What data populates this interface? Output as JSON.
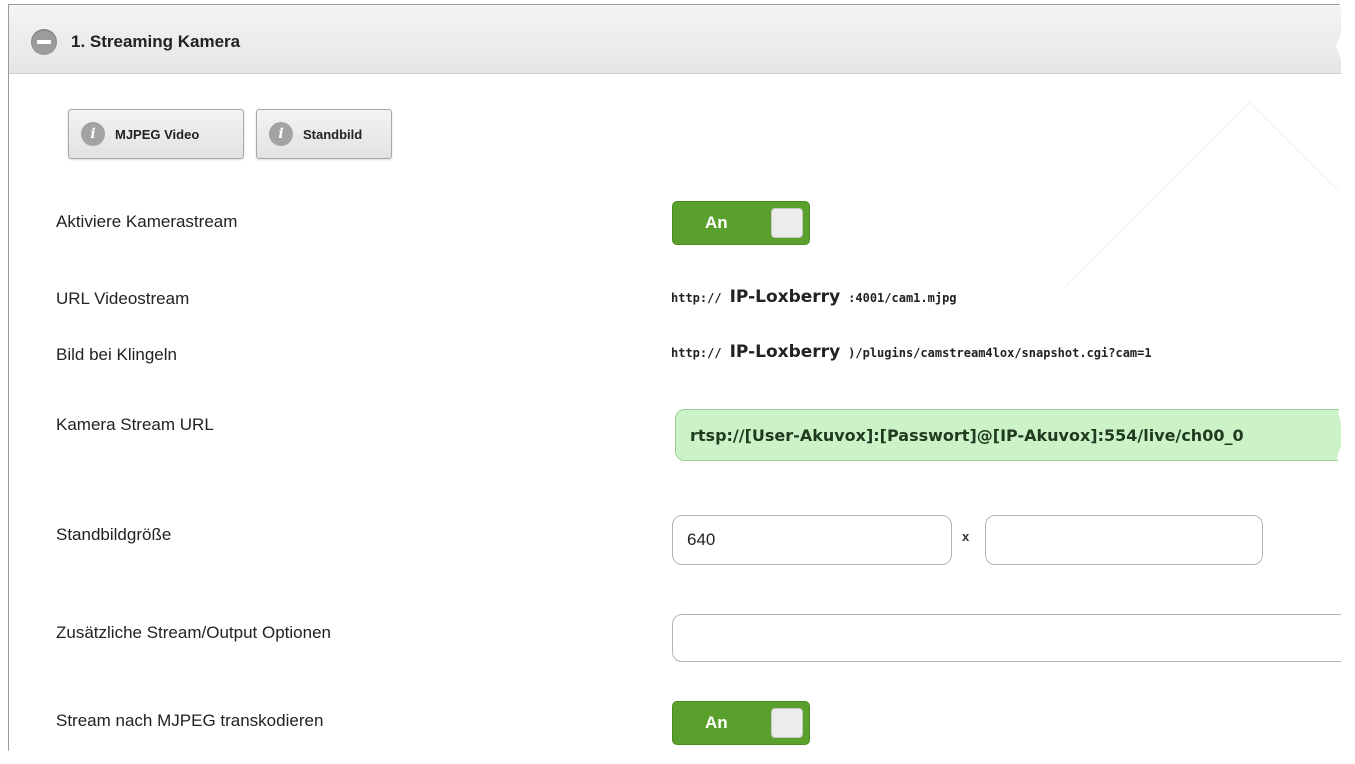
{
  "header": {
    "title": "1. Streaming Kamera"
  },
  "buttons": {
    "mjpeg_video": "MJPEG Video",
    "standbild": "Standbild",
    "info_glyph": "i"
  },
  "rows": {
    "aktiviere": {
      "label": "Aktiviere Kamerastream",
      "toggle_text": "An"
    },
    "url_videostream": {
      "label": "URL Videostream",
      "prefix": "http://",
      "host": "IP-Loxberry",
      "suffix": ":4001/cam1.mjpg"
    },
    "bild_klingeln": {
      "label": "Bild bei Klingeln",
      "prefix": "http://",
      "host": "IP-Loxberry",
      "suffix": ")/plugins/camstream4lox/snapshot.cgi?cam=1"
    },
    "kamera_stream_url": {
      "label": "Kamera Stream URL",
      "value": "rtsp://[User-Akuvox]:[Passwort]@[IP-Akuvox]:554/live/ch00_0"
    },
    "standbildgroesse": {
      "label": "Standbildgröße",
      "width_value": "640",
      "separator": "x",
      "height_value": ""
    },
    "zusaetzliche_optionen": {
      "label": "Zusätzliche Stream/Output Optionen",
      "value": ""
    },
    "transkodieren": {
      "label": "Stream nach MJPEG transkodieren",
      "toggle_text": "An"
    }
  },
  "colors": {
    "toggle_on": "#5aa02c",
    "stream_url_bg": "#ccf2c8"
  }
}
